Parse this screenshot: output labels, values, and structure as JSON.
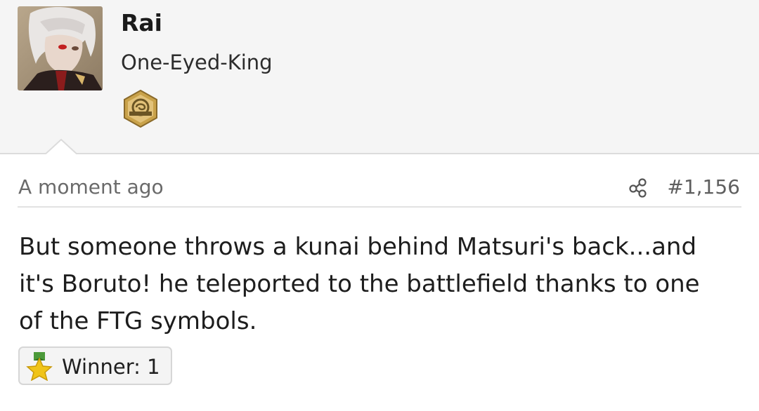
{
  "user": {
    "name": "Rai",
    "title": "One-Eyed-King"
  },
  "post": {
    "timestamp": "A moment ago",
    "number": "#1,156",
    "body": "But someone throws a kunai behind Matsuri's back...and it's Boruto! he teleported to the battlefield thanks to one of the FTG symbols."
  },
  "reaction": {
    "label": "Winner: 1",
    "icon": "winner-star-icon"
  },
  "icons": {
    "share": "share-icon",
    "badge": "fanverse-badge-icon"
  },
  "colors": {
    "header_bg": "#f5f5f5",
    "badge_gold": "#c9a24a",
    "badge_dark": "#6b5524",
    "star": "#f0c419",
    "ribbon": "#4c9a3a"
  }
}
